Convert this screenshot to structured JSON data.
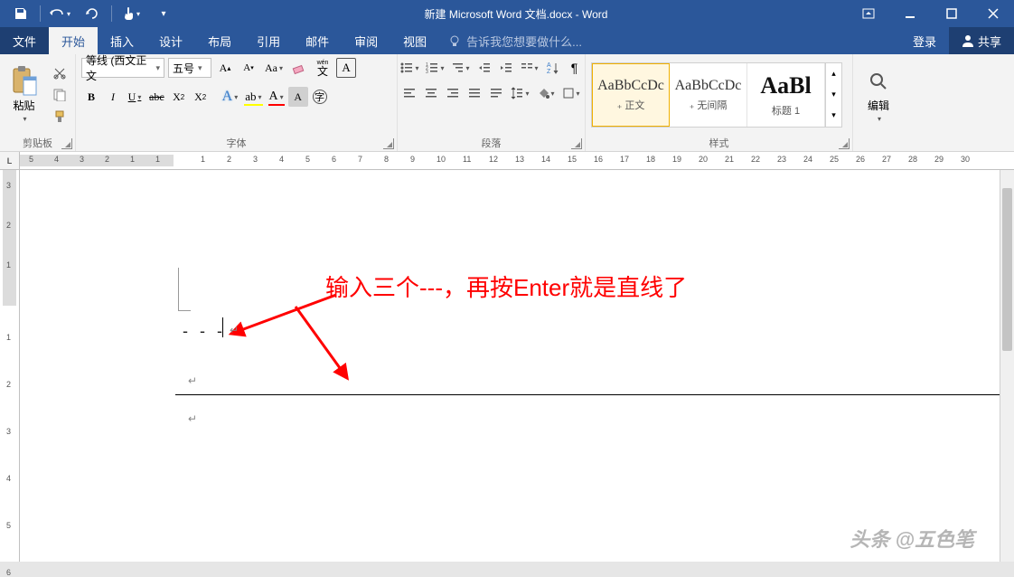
{
  "title": "新建 Microsoft Word 文档.docx - Word",
  "menu": {
    "file": "文件",
    "home": "开始",
    "insert": "插入",
    "design": "设计",
    "layout": "布局",
    "references": "引用",
    "mail": "邮件",
    "review": "审阅",
    "view": "视图",
    "tell_me": "告诉我您想要做什么...",
    "signin": "登录",
    "share": "共享"
  },
  "ribbon": {
    "clipboard": {
      "label": "剪贴板",
      "paste": "粘贴"
    },
    "font": {
      "label": "字体",
      "name": "等线 (西文正文",
      "size": "五号",
      "phonetic": "wén"
    },
    "paragraph": {
      "label": "段落"
    },
    "styles": {
      "label": "样式",
      "preview": "AaBbCcDc",
      "heading_preview": "AaBl",
      "normal": "₊ 正文",
      "nospacing": "₊ 无间隔",
      "heading1": "标题 1"
    },
    "editing": {
      "label": "编辑"
    }
  },
  "ruler": {
    "corner": "L",
    "left": [
      "5",
      "4",
      "3",
      "2",
      "1",
      "1"
    ],
    "right": [
      "1",
      "2",
      "3",
      "4",
      "5",
      "6",
      "7",
      "8",
      "9",
      "10",
      "11",
      "12",
      "13",
      "14",
      "15",
      "16",
      "17",
      "18",
      "19",
      "20",
      "21",
      "22",
      "23",
      "24",
      "25",
      "26",
      "27",
      "28",
      "29",
      "30"
    ],
    "vtop": [
      "3",
      "2",
      "1"
    ],
    "vmain": [
      "1",
      "2",
      "3",
      "4",
      "5",
      "6"
    ]
  },
  "doc": {
    "annotation": "输入三个---，再按Enter就是直线了",
    "dashes": "- - -",
    "paramark": "↵"
  },
  "watermark": "头条 @五色笔"
}
